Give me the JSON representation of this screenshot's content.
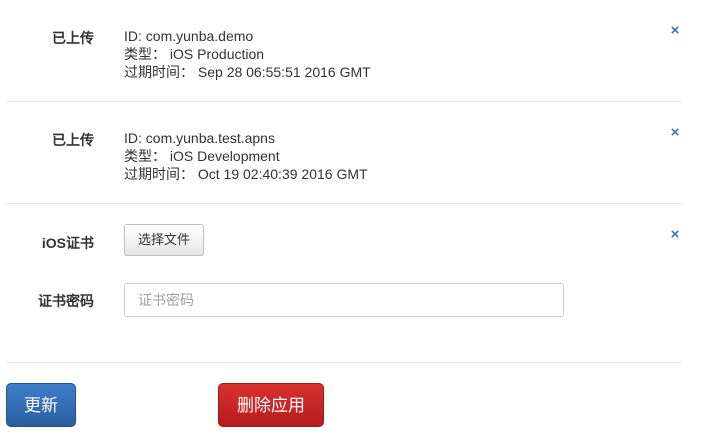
{
  "certificates": [
    {
      "status": "已上传",
      "id_line": "ID: com.yunba.demo",
      "type_line": "类型： iOS Production",
      "expiry_line": "过期时间： Sep 28 06:55:51 2016 GMT",
      "remove_icon": "×"
    },
    {
      "status": "已上传",
      "id_line": "ID: com.yunba.test.apns",
      "type_line": "类型： iOS Development",
      "expiry_line": "过期时间： Oct 19 02:40:39 2016 GMT",
      "remove_icon": "×"
    }
  ],
  "upload": {
    "cert_label": "iOS证书",
    "choose_file_label": "选择文件",
    "remove_icon": "×",
    "password_label": "证书密码",
    "password_placeholder": "证书密码",
    "password_value": ""
  },
  "actions": {
    "update_label": "更新",
    "delete_label": "删除应用"
  },
  "colors": {
    "primary": "#2f6bb3",
    "danger": "#c9232a",
    "close_icon": "#3a75b8"
  },
  "icons": {
    "remove": "close-icon"
  }
}
